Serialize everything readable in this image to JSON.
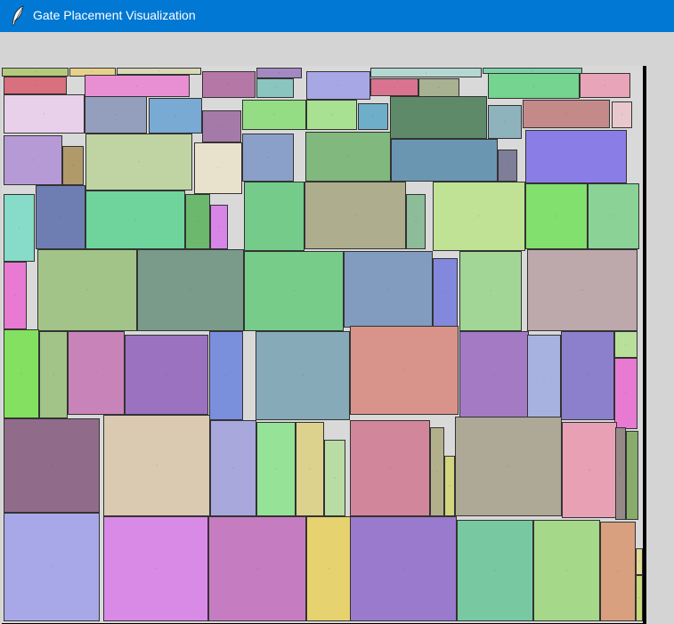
{
  "window": {
    "title": "Gate Placement Visualization",
    "icon": "feather-icon"
  },
  "gates": [
    {
      "color": "#b5c97d"
    },
    {
      "color": "#e6d28a"
    },
    {
      "color": "#d9d9b8"
    },
    {
      "color": "#a488c2"
    },
    {
      "color": "#b5d7d2"
    },
    {
      "color": "#7dd2a8"
    },
    {
      "color": "#d9707e"
    },
    {
      "color": "#e88fd3"
    },
    {
      "color": "#b577a5"
    },
    {
      "color": "#8ac5c0"
    },
    {
      "color": "#a7a7e6"
    },
    {
      "color": "#d9738f"
    },
    {
      "color": "#a8b191"
    },
    {
      "color": "#75d48f"
    },
    {
      "color": "#e8a4b8"
    },
    {
      "color": "#e8d0ea"
    },
    {
      "color": "#949fbe"
    },
    {
      "color": "#78aad4"
    },
    {
      "color": "#a47aa8"
    },
    {
      "color": "#94dd84"
    },
    {
      "color": "#a8e191"
    },
    {
      "color": "#6eaec8"
    },
    {
      "color": "#5f8a6a"
    },
    {
      "color": "#8fb3bd"
    },
    {
      "color": "#c48a8a"
    },
    {
      "color": "#e8c8cc"
    },
    {
      "color": "#b59ad6"
    },
    {
      "color": "#b09a6a"
    },
    {
      "color": "#c0d3a2"
    },
    {
      "color": "#e8e2cc"
    },
    {
      "color": "#8aa0c8"
    },
    {
      "color": "#80b87e"
    },
    {
      "color": "#6a96b2"
    },
    {
      "color": "#7e7e99"
    },
    {
      "color": "#8a7ee6"
    },
    {
      "color": "#86dcc8"
    },
    {
      "color": "#6e7eb2"
    },
    {
      "color": "#6ed49b"
    },
    {
      "color": "#6cb86c"
    },
    {
      "color": "#d885e8"
    },
    {
      "color": "#75cc8a"
    },
    {
      "color": "#aeae8e"
    },
    {
      "color": "#8cbc98"
    },
    {
      "color": "#c0e294"
    },
    {
      "color": "#82e06e"
    },
    {
      "color": "#8ad296"
    },
    {
      "color": "#e87ad2"
    },
    {
      "color": "#a2c489"
    },
    {
      "color": "#7a9a8a"
    },
    {
      "color": "#78cc8a"
    },
    {
      "color": "#829cc0"
    },
    {
      "color": "#8288dc"
    },
    {
      "color": "#a2d696"
    },
    {
      "color": "#bda8ac"
    },
    {
      "color": "#84e060"
    },
    {
      "color": "#a2c489"
    },
    {
      "color": "#c884b8"
    },
    {
      "color": "#9a72c0"
    },
    {
      "color": "#7a90dc"
    },
    {
      "color": "#86aab8"
    },
    {
      "color": "#d8948a"
    },
    {
      "color": "#a47ac4"
    },
    {
      "color": "#a8b2e0"
    },
    {
      "color": "#8c80cc"
    },
    {
      "color": "#b8e09a"
    },
    {
      "color": "#e87ad2"
    },
    {
      "color": "#906c8a"
    },
    {
      "color": "#dacab2"
    },
    {
      "color": "#a8a8dc"
    },
    {
      "color": "#96e296"
    },
    {
      "color": "#dcd28e"
    },
    {
      "color": "#b8dca4"
    },
    {
      "color": "#d2869c"
    },
    {
      "color": "#b2b08a"
    },
    {
      "color": "#d2d47e"
    },
    {
      "color": "#aea896"
    },
    {
      "color": "#e8a0b4"
    },
    {
      "color": "#968a88"
    },
    {
      "color": "#88ac6c"
    },
    {
      "color": "#a8a8e8"
    },
    {
      "color": "#d88ae6"
    },
    {
      "color": "#c67cc0"
    },
    {
      "color": "#e6d26e"
    },
    {
      "color": "#9a7acc"
    },
    {
      "color": "#78c8a2"
    },
    {
      "color": "#a6d88a"
    },
    {
      "color": "#d8a07e"
    },
    {
      "color": "#e2da96"
    },
    {
      "color": "#c6d87c"
    },
    {
      "color": "#c8a8b8"
    },
    {
      "color": "#9a70d4"
    }
  ]
}
